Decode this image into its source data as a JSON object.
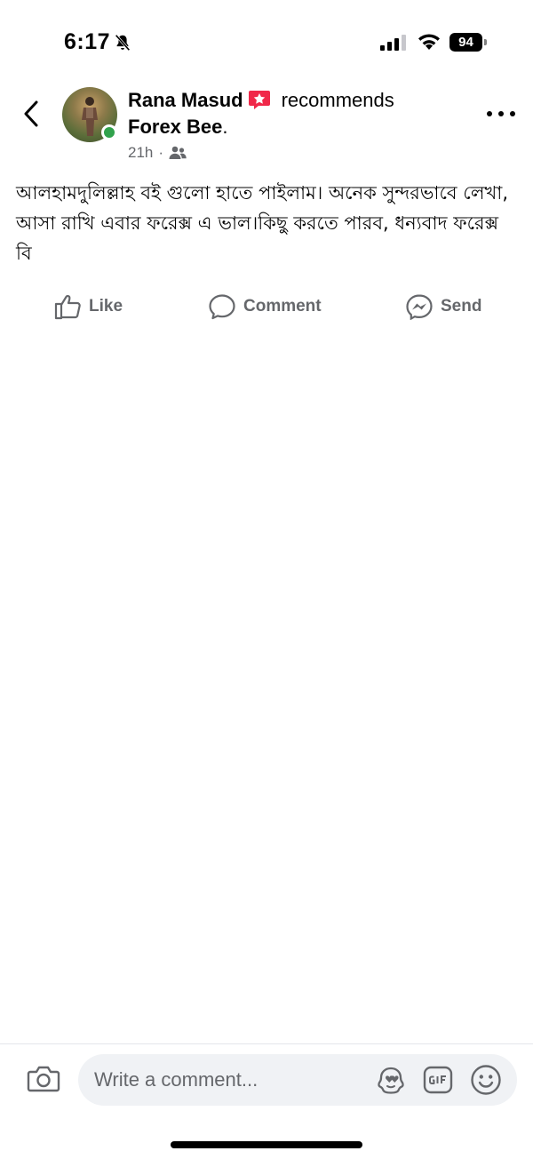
{
  "status_bar": {
    "time": "6:17",
    "battery": "94"
  },
  "post": {
    "author": "Rana Masud",
    "action_text": "recommends",
    "page_name": "Forex Bee",
    "page_suffix": ".",
    "timestamp": "21h",
    "separator": "·",
    "privacy_icon": "friends-icon",
    "body": "আলহামদুলিল্লাহ বই গুলো হাতে পাইলাম। অনেক সুন্দরভাবে লেখা, আসা রাখি এবার ফরেক্স এ ভাল।কিছু করতে পারব,  ধন্যবাদ ফরেক্স বি"
  },
  "actions": {
    "like_label": "Like",
    "comment_label": "Comment",
    "send_label": "Send"
  },
  "composer": {
    "placeholder": "Write a comment..."
  },
  "colors": {
    "online": "#31a24c",
    "recommend_badge": "#f02849",
    "secondary_text": "#65676b",
    "input_bg": "#f0f2f5"
  }
}
